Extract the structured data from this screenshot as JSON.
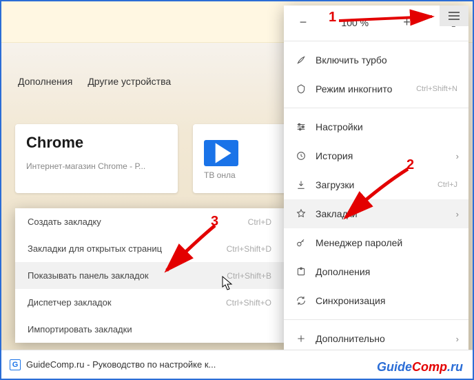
{
  "tabs": {
    "addons": "Дополнения",
    "other_devices": "Другие устройства"
  },
  "cards": {
    "chrome_title": "Chrome",
    "chrome_sub": "Интернет-магазин Chrome - Р...",
    "tv_sub": "ТВ онла"
  },
  "submenu": {
    "create": "Создать закладку",
    "create_kbd": "Ctrl+D",
    "open_tabs": "Закладки для открытых страниц",
    "open_tabs_kbd": "Ctrl+Shift+D",
    "show_bar": "Показывать панель закладок",
    "show_bar_kbd": "Ctrl+Shift+B",
    "manager": "Диспетчер закладок",
    "manager_kbd": "Ctrl+Shift+O",
    "import": "Импортировать закладки"
  },
  "menu": {
    "zoom": "100 %",
    "turbo": "Включить турбо",
    "incognito": "Режим инкогнито",
    "incognito_kbd": "Ctrl+Shift+N",
    "settings": "Настройки",
    "history": "История",
    "downloads": "Загрузки",
    "downloads_kbd": "Ctrl+J",
    "bookmarks": "Закладки",
    "passwords": "Менеджер паролей",
    "addons": "Дополнения",
    "sync": "Синхронизация",
    "more": "Дополнительно"
  },
  "footer": {
    "favicon_letter": "G",
    "text": "GuideComp.ru - Руководство по настройке к..."
  },
  "watermark": {
    "p1": "Guide",
    "p2": "Comp",
    "p3": ".ru"
  },
  "annot": {
    "n1": "1",
    "n2": "2",
    "n3": "3"
  }
}
